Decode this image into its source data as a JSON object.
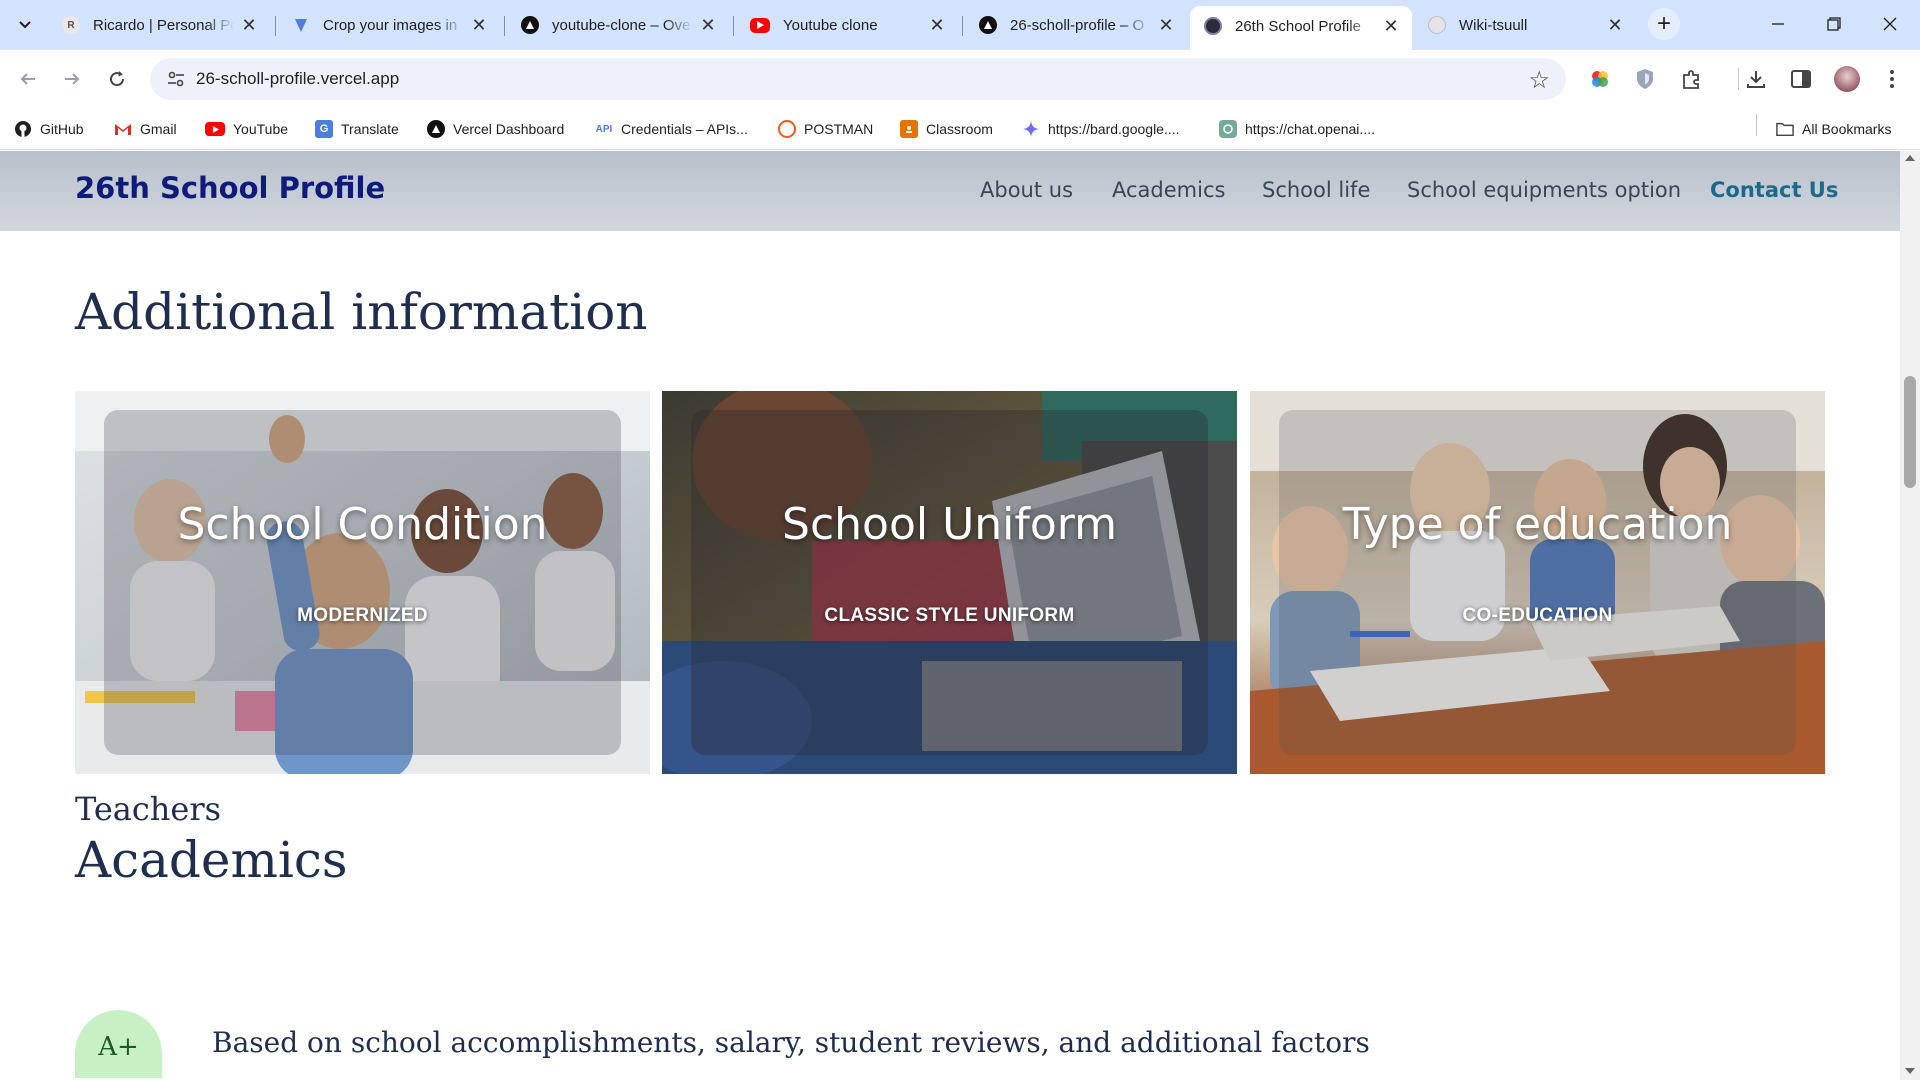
{
  "browser": {
    "tabs": [
      {
        "title": "Ricardo | Personal Po",
        "favicon": "R"
      },
      {
        "title": "Crop your images in",
        "favicon": "crop-icon"
      },
      {
        "title": "youtube-clone – Ove",
        "favicon": "vercel-icon"
      },
      {
        "title": "Youtube clone",
        "favicon": "youtube-icon"
      },
      {
        "title": "26-scholl-profile – O",
        "favicon": "vercel-icon"
      },
      {
        "title": "26th School Profile",
        "favicon": "site-icon",
        "active": true
      },
      {
        "title": "Wiki-tsuull",
        "favicon": "globe-icon"
      }
    ],
    "url": "26-scholl-profile.vercel.app",
    "bookmarks": [
      {
        "label": "GitHub",
        "icon": "github-icon"
      },
      {
        "label": "Gmail",
        "icon": "gmail-icon"
      },
      {
        "label": "YouTube",
        "icon": "youtube-icon"
      },
      {
        "label": "Translate",
        "icon": "translate-icon"
      },
      {
        "label": "Vercel Dashboard",
        "icon": "vercel-icon"
      },
      {
        "label": "Credentials – APIs...",
        "icon": "api-icon"
      },
      {
        "label": "POSTMAN",
        "icon": "postman-icon"
      },
      {
        "label": "Classroom",
        "icon": "classroom-icon"
      },
      {
        "label": "https://bard.google....",
        "icon": "bard-icon"
      },
      {
        "label": "https://chat.openai....",
        "icon": "openai-icon"
      }
    ],
    "all_bookmarks": "All Bookmarks"
  },
  "site": {
    "brand": "26th School Profile",
    "nav": [
      "About us",
      "Academics",
      "School life",
      "School equipments option",
      "Contact Us"
    ],
    "additional_heading": "Additional information",
    "cards": [
      {
        "title": "School Condition",
        "subtitle": "MODERNIZED"
      },
      {
        "title": "School Uniform",
        "subtitle": "CLASSIC STYLE UNIFORM"
      },
      {
        "title": "Type of education",
        "subtitle": "CO-EDUCATION"
      }
    ],
    "academics_heading": "Academics",
    "teachers_heading": "Teachers",
    "teacher_grade": "A+",
    "teacher_grade_text": "Based on school accomplishments, salary, student reviews, and additional factors"
  },
  "colors": {
    "brand": "#0f1b7a",
    "contact_accent": "#1b6a8e",
    "heading": "#1f2d4f",
    "grade_badge": "#c7f0c4"
  }
}
